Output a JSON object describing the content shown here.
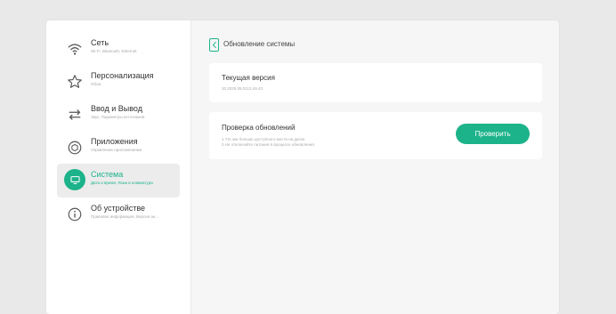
{
  "sidebar": {
    "items": [
      {
        "title": "Сеть",
        "subtitle": "Wi-Fi, Bluetooth, Ethernet",
        "icon": "wifi-icon"
      },
      {
        "title": "Персонализация",
        "subtitle": "Обои",
        "icon": "star-icon"
      },
      {
        "title": "Ввод и Вывод",
        "subtitle": "Звук, Параметры источников",
        "icon": "arrows-icon"
      },
      {
        "title": "Приложения",
        "subtitle": "Управление приложениями",
        "icon": "apps-icon"
      },
      {
        "title": "Система",
        "subtitle": "Дата и время, Язык и клавиатура",
        "icon": "monitor-icon",
        "active": true
      },
      {
        "title": "Об устройстве",
        "subtitle": "Правовая информация, Версия ан...",
        "icon": "info-icon"
      }
    ]
  },
  "main": {
    "title": "Обновление системы",
    "current_version": {
      "title": "Текущая версия",
      "value": "20.2025.08.0113.49.43"
    },
    "update_check": {
      "title": "Проверка обновлений",
      "notes": [
        "1.Т.Е.ник больше доступного места на диске.",
        "2.Не отключайте питание в процессе обновления."
      ],
      "button_label": "Проверить"
    }
  },
  "colors": {
    "accent": "#1db38a",
    "background": "#e9e9ea",
    "panel": "#f6f6f6",
    "card": "#ffffff"
  }
}
